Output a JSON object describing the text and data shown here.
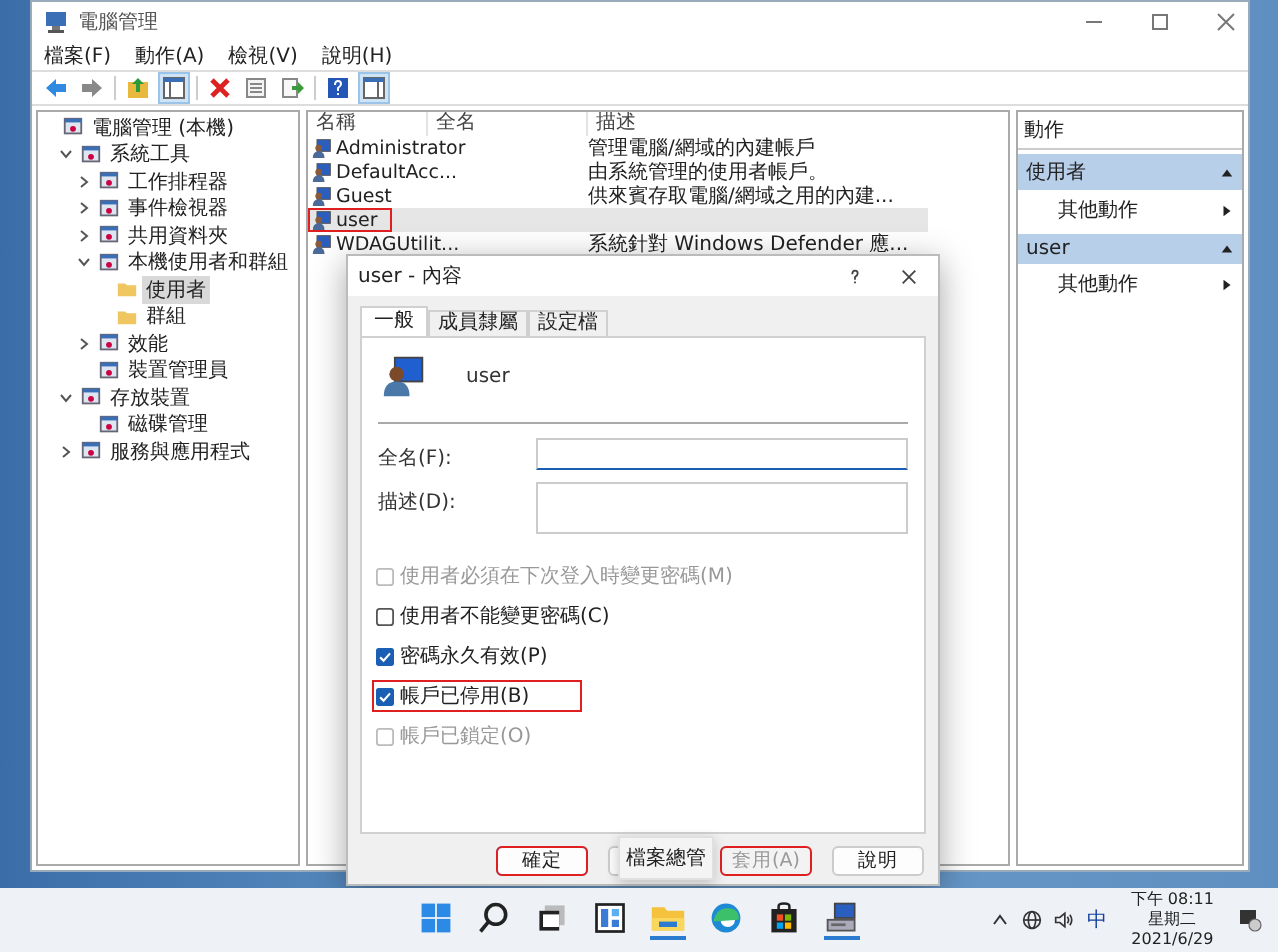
{
  "window": {
    "title": "電腦管理"
  },
  "menu": [
    "檔案(F)",
    "動作(A)",
    "檢視(V)",
    "說明(H)"
  ],
  "tree": [
    {
      "label": "電腦管理 (本機)",
      "selected": false,
      "children": [
        {
          "label": "系統工具",
          "expanded": true,
          "selected": false,
          "children": [
            {
              "label": "工作排程器",
              "expanded": false,
              "selected": false
            },
            {
              "label": "事件檢視器",
              "expanded": false,
              "selected": false
            },
            {
              "label": "共用資料夾",
              "expanded": false,
              "selected": false
            },
            {
              "label": "本機使用者和群組",
              "expanded": true,
              "selected": false,
              "children": [
                {
                  "label": "使用者",
                  "selected": true
                },
                {
                  "label": "群組",
                  "selected": false
                }
              ]
            },
            {
              "label": "效能",
              "expanded": false,
              "selected": false
            },
            {
              "label": "裝置管理員",
              "selected": false
            }
          ]
        },
        {
          "label": "存放裝置",
          "expanded": true,
          "selected": false,
          "children": [
            {
              "label": "磁碟管理",
              "selected": false
            }
          ]
        },
        {
          "label": "服務與應用程式",
          "expanded": false,
          "selected": false
        }
      ]
    }
  ],
  "list": {
    "columns": [
      "名稱",
      "全名",
      "描述"
    ],
    "rows": [
      {
        "name": "Administrator",
        "description": "管理電腦/網域的內建帳戶",
        "selected": false,
        "highlighted": false
      },
      {
        "name": "DefaultAcc...",
        "description": "由系統管理的使用者帳戶。",
        "selected": false,
        "highlighted": false
      },
      {
        "name": "Guest",
        "description": "供來賓存取電腦/網域之用的內建...",
        "selected": false,
        "highlighted": false
      },
      {
        "name": "user",
        "selected": true,
        "highlighted": true
      },
      {
        "name": "WDAGUtilit...",
        "description": "系統針對 Windows Defender 應...",
        "selected": false,
        "highlighted": false
      }
    ]
  },
  "actions": {
    "title": "動作",
    "sections": [
      {
        "title": "使用者",
        "items": [
          "其他動作"
        ]
      },
      {
        "title": "user",
        "items": [
          "其他動作"
        ]
      }
    ]
  },
  "dialog": {
    "title": "user - 內容",
    "tabs": [
      {
        "label": "一般",
        "selected": true
      },
      {
        "label": "成員隸屬",
        "selected": false
      },
      {
        "label": "設定檔",
        "selected": false
      }
    ],
    "username": "user",
    "fields": [
      {
        "label": "全名(F):",
        "kind": "input"
      },
      {
        "label": "描述(D):",
        "kind": "textarea"
      }
    ],
    "checkboxes": [
      {
        "label": "使用者必須在下次登入時變更密碼(M)",
        "checked": false,
        "disabled": true,
        "highlighted": false
      },
      {
        "label": "使用者不能變更密碼(C)",
        "checked": false,
        "disabled": false,
        "highlighted": false
      },
      {
        "label": "密碼永久有效(P)",
        "checked": true,
        "disabled": false,
        "highlighted": false
      },
      {
        "label": "帳戶已停用(B)",
        "checked": true,
        "disabled": false,
        "highlighted": true
      },
      {
        "label": "帳戶已鎖定(O)",
        "checked": false,
        "disabled": true,
        "highlighted": false
      }
    ],
    "buttons": [
      {
        "label": "確定",
        "disabled": false,
        "highlighted": true
      },
      {
        "disabled": false,
        "highlighted": false
      },
      {
        "label": "套用(A)",
        "disabled": true,
        "highlighted": true
      },
      {
        "label": "說明",
        "disabled": false,
        "highlighted": false
      }
    ]
  },
  "tooltip": "檔案總管",
  "clock": {
    "time": "下午 08:11",
    "weekday": "星期二",
    "date": "2021/6/29"
  },
  "tray": {
    "ime": "中"
  }
}
